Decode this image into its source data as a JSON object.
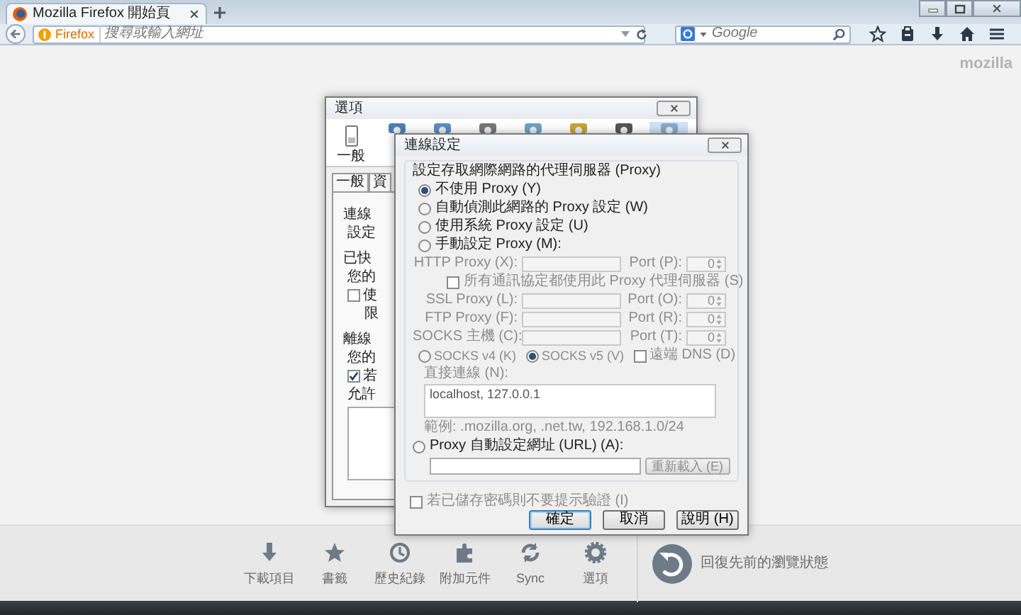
{
  "browser": {
    "tab": {
      "title": "Mozilla Firefox 開始頁",
      "selected": true
    },
    "identity": "Firefox",
    "url_placeholder": "搜尋或輸入網址",
    "search_placeholder": "Google"
  },
  "brand": "mozilla",
  "options_dialog": {
    "title": "選項",
    "panes": [
      {
        "label": "一般",
        "selected": false
      },
      {
        "selected": false
      },
      {
        "selected": false
      },
      {
        "selected": false
      },
      {
        "selected": false
      },
      {
        "selected": false
      },
      {
        "selected": false
      },
      {
        "selected": true
      }
    ],
    "tabs": [
      {
        "label": "一般"
      },
      {
        "label": "資"
      }
    ],
    "lines": [
      {
        "kind": "heading",
        "text": "連線"
      },
      {
        "kind": "text",
        "text": "設定"
      },
      {
        "kind": "heading",
        "text": "已快"
      },
      {
        "kind": "text",
        "text": "您的"
      },
      {
        "kind": "checkbox",
        "text": "使",
        "checked": false
      },
      {
        "kind": "indent",
        "text": "限"
      },
      {
        "kind": "heading",
        "text": "離線"
      },
      {
        "kind": "text",
        "text": "您的"
      },
      {
        "kind": "checkbox",
        "text": "若",
        "checked": true
      },
      {
        "kind": "text",
        "text": "允許"
      },
      {
        "kind": "listbox"
      }
    ]
  },
  "connection_dialog": {
    "title": "連線設定",
    "legend": "設定存取網際網路的代理伺服器 (Proxy)",
    "modes": [
      {
        "label": "不使用 Proxy (Y)",
        "selected": true
      },
      {
        "label": "自動偵測此網路的 Proxy 設定 (W)",
        "selected": false
      },
      {
        "label": "使用系統 Proxy 設定 (U)",
        "selected": false
      },
      {
        "label": "手動設定 Proxy (M):",
        "selected": false
      }
    ],
    "manual": {
      "disabled": true,
      "proxies": [
        {
          "label": "HTTP Proxy (X):",
          "port_label": "Port (P):",
          "port": "0"
        },
        {
          "label": "SSL Proxy (L):",
          "port_label": "Port (O):",
          "port": "0"
        },
        {
          "label": "FTP Proxy (F):",
          "port_label": "Port (R):",
          "port": "0"
        },
        {
          "label": "SOCKS 主機 (C):",
          "port_label": "Port (T):",
          "port": "0"
        }
      ],
      "share": {
        "label": "所有通訊協定都使用此 Proxy 代理伺服器 (S)",
        "checked": false
      },
      "socks_versions": [
        {
          "label": "SOCKS v4 (K)",
          "selected": false
        },
        {
          "label": "SOCKS v5 (V)",
          "selected": true
        }
      ],
      "remote_dns": {
        "label": "遠端 DNS (D)",
        "checked": false
      },
      "no_proxy_label": "直接連線 (N):",
      "no_proxy_value": "localhost, 127.0.0.1",
      "example": "範例: .mozilla.org, .net.tw, 192.168.1.0/24"
    },
    "autoconfig": {
      "label": "Proxy 自動設定網址 (URL) (A):",
      "selected": false,
      "reload": "重新載入 (E)"
    },
    "auth": {
      "label": "若已儲存密碼則不要提示驗證 (I)",
      "checked": false
    },
    "buttons": [
      {
        "label": "確定",
        "default": true
      },
      {
        "label": "取消",
        "default": false
      },
      {
        "label": "說明 (H)",
        "default": false
      }
    ]
  },
  "launcher": {
    "items": [
      {
        "label": "下載項目",
        "kind": "download"
      },
      {
        "label": "書籤",
        "kind": "bookmark"
      },
      {
        "label": "歷史紀錄",
        "kind": "history"
      },
      {
        "label": "附加元件",
        "kind": "addons"
      },
      {
        "label": "Sync",
        "kind": "sync"
      },
      {
        "label": "選項",
        "kind": "settings"
      }
    ],
    "restore": "回復先前的瀏覽狀態"
  }
}
